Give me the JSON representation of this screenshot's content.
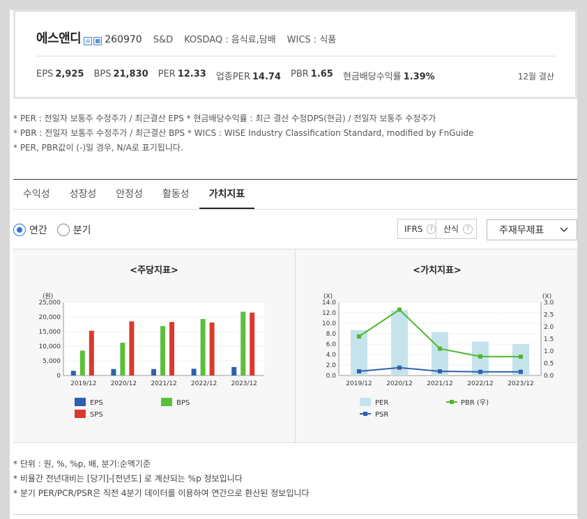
{
  "corp": {
    "name": "에스앤디",
    "code": "260970",
    "eng_name": "S&D",
    "market": "KOSDAQ : 음식료,담배",
    "wics": "WICS : 식품",
    "stats": [
      {
        "label": "EPS",
        "value": "2,925"
      },
      {
        "label": "BPS",
        "value": "21,830"
      },
      {
        "label": "PER",
        "value": "12.33"
      },
      {
        "label": "업종PER",
        "value": "14.74"
      },
      {
        "label": "PBR",
        "value": "1.65"
      },
      {
        "label": "현금배당수익률",
        "value": "1.39%"
      }
    ],
    "settlement": "12월 결산"
  },
  "notes": [
    "* PER : 전일자 보통주 수정주가 / 최근결산 EPS * 현금배당수익률 : 최근 결산 수정DPS(현금) / 전일자 보통주 수정주가",
    "* PBR : 전일자 보통주 수정주가 / 최근결산 BPS * WICS : WISE Industry Classification Standard, modified by FnGuide",
    "* PER, PBR값이 (-)일 경우, N/A로 표기됩니다."
  ],
  "tabs": [
    "수익성",
    "성장성",
    "안정성",
    "활동성",
    "가치지표"
  ],
  "active_tab": "가치지표",
  "period": {
    "annual": "연간",
    "quarter": "분기",
    "selected": "annual"
  },
  "ifrs_label": "IFRS",
  "calc_label": "산식",
  "statement_select": "주재무제표",
  "colors": {
    "eps": "#2e5fb0",
    "bps": "#5cbf3a",
    "sps": "#d93a2e",
    "per": "#c5e3ea",
    "pbr": "#4fb52e",
    "psr": "#2e5fb0"
  },
  "chart_data": [
    {
      "type": "bar",
      "title": "<주당지표>",
      "unit_label": "(원)",
      "categories": [
        "2019/12",
        "2020/12",
        "2021/12",
        "2022/12",
        "2023/12"
      ],
      "series": [
        {
          "name": "EPS",
          "values": [
            1600,
            2200,
            2200,
            2300,
            2900
          ]
        },
        {
          "name": "BPS",
          "values": [
            8500,
            11200,
            16900,
            19300,
            21800
          ]
        },
        {
          "name": "SPS",
          "values": [
            15300,
            18500,
            18300,
            18100,
            21500
          ]
        }
      ],
      "ylim": [
        0,
        25000
      ],
      "yticks": [
        "0",
        "5,000",
        "10,000",
        "15,000",
        "20,000",
        "25,000"
      ],
      "grid": true,
      "legend_position": "bottom"
    },
    {
      "type": "bar",
      "title": "<가치지표>",
      "left_unit": "(X)",
      "right_unit": "(X)",
      "categories": [
        "2019/12",
        "2020/12",
        "2021/12",
        "2022/12",
        "2023/12"
      ],
      "series": [
        {
          "name": "PER",
          "type": "bar",
          "axis": "left",
          "values": [
            8.7,
            12.5,
            8.3,
            6.5,
            6.0
          ]
        },
        {
          "name": "PBR (우)",
          "type": "line",
          "axis": "right",
          "values": [
            1.6,
            2.7,
            1.1,
            0.78,
            0.77
          ]
        },
        {
          "name": "PSR",
          "type": "line",
          "axis": "left",
          "values": [
            0.8,
            1.5,
            0.8,
            0.7,
            0.7
          ]
        }
      ],
      "ylim_left": [
        0,
        14
      ],
      "ylim_right": [
        0,
        3
      ],
      "yticks_left": [
        "0.0",
        "2.0",
        "4.0",
        "6.0",
        "8.0",
        "10.0",
        "12.0",
        "14.0"
      ],
      "yticks_right": [
        "0.0",
        "0.5",
        "1.0",
        "1.5",
        "2.0",
        "2.5",
        "3.0"
      ],
      "grid": true,
      "legend_position": "bottom"
    }
  ],
  "footnotes": [
    "* 단위 : 원, %, %p, 배, 분기:순액기준",
    "* 비율간 전년대비는 [당기]-[전년도] 로 계산되는 %p 정보입니다",
    "* 분기 PER/PCR/PSR은 직전 4분기 데이터를 이용하여 연간으로 환산된 정보입니다"
  ]
}
